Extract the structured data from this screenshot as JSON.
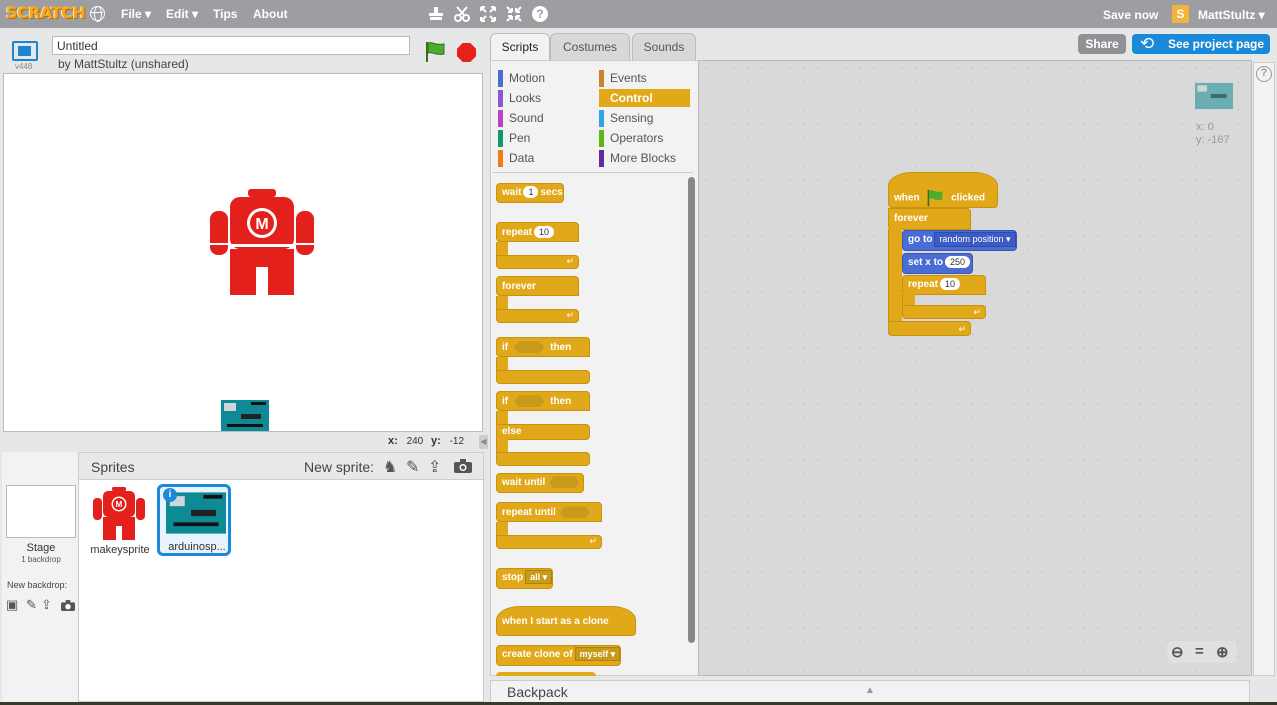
{
  "menu": {
    "logo": "SCRATCH",
    "file": "File ▾",
    "edit": "Edit ▾",
    "tips": "Tips",
    "about": "About",
    "save_now": "Save now",
    "user_initial": "S",
    "username": "MattStultz ▾"
  },
  "project": {
    "version": "v448",
    "title": "Untitled",
    "author": "by MattStultz (unshared)"
  },
  "stage": {
    "x_label": "x:",
    "x_value": "240",
    "y_label": "y:",
    "y_value": "-12"
  },
  "sprites": {
    "header": "Sprites",
    "new_sprite": "New sprite:",
    "stage_name": "Stage",
    "stage_sub": "1 backdrop",
    "new_backdrop": "New backdrop:",
    "items": [
      {
        "name": "makeysprite"
      },
      {
        "name": "arduinosp..."
      }
    ],
    "info_icon": "i"
  },
  "tabs": [
    "Scripts",
    "Costumes",
    "Sounds"
  ],
  "categories": [
    {
      "label": "Motion",
      "color": "#4a6cd4"
    },
    {
      "label": "Looks",
      "color": "#8a55d7"
    },
    {
      "label": "Sound",
      "color": "#bb42c3"
    },
    {
      "label": "Pen",
      "color": "#0e9a6c"
    },
    {
      "label": "Data",
      "color": "#ee7d16"
    },
    {
      "label": "Events",
      "color": "#c88330"
    },
    {
      "label": "Control",
      "color": "#e1a91a"
    },
    {
      "label": "Sensing",
      "color": "#2ca5e2"
    },
    {
      "label": "Operators",
      "color": "#5cb712"
    },
    {
      "label": "More Blocks",
      "color": "#632d99"
    }
  ],
  "palette": {
    "wait": "wait",
    "wait_arg": "1",
    "secs": "secs",
    "repeat": "repeat",
    "repeat_arg": "10",
    "forever": "forever",
    "if": "if",
    "then": "then",
    "else": "else",
    "wait_until": "wait until",
    "repeat_until": "repeat until",
    "stop": "stop",
    "stop_arg": "all",
    "when_clone": "when I start as a clone",
    "create_clone": "create clone of",
    "create_clone_arg": "myself"
  },
  "script": {
    "when": "when",
    "clicked": "clicked",
    "forever": "forever",
    "go_to": "go to",
    "go_to_arg": "random position",
    "set_x": "set x to",
    "set_x_arg": "250",
    "repeat": "repeat",
    "repeat_arg": "10"
  },
  "header_buttons": {
    "share": "Share",
    "see_project": "See project page"
  },
  "script_area": {
    "x_readout": "x: 0",
    "y_readout": "y: -167"
  },
  "backpack": {
    "label": "Backpack"
  }
}
